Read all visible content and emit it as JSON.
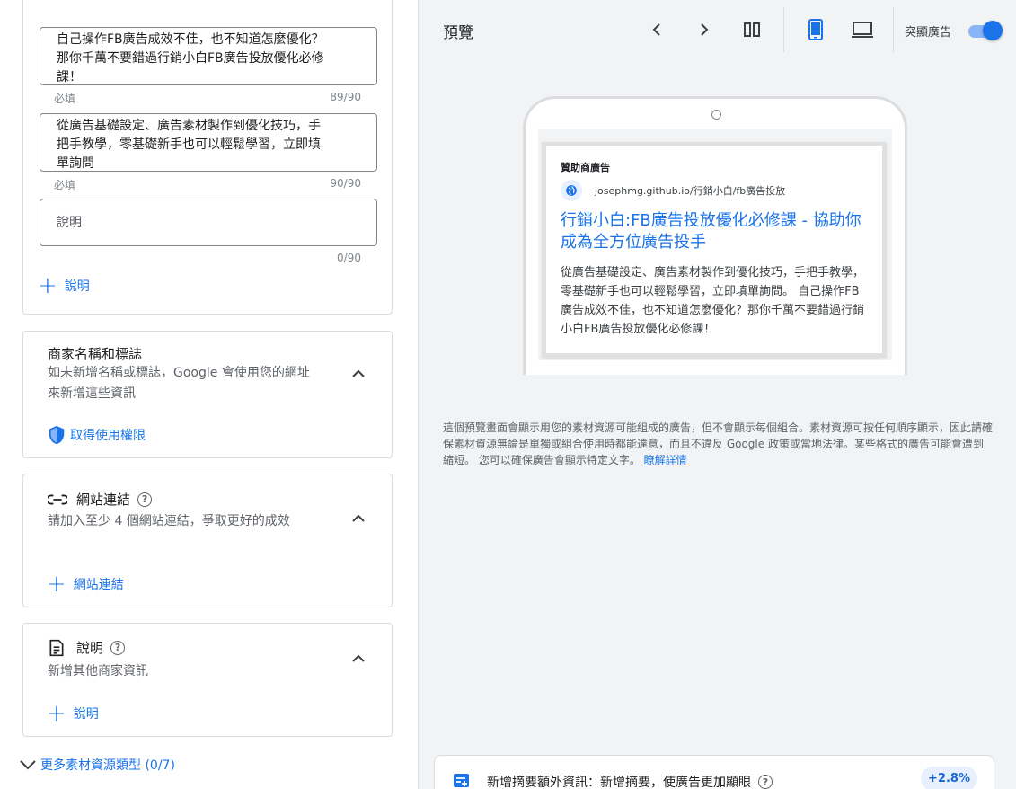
{
  "assets": {
    "field1_text": "自己操作FB廣告成效不佳，也不知道怎麼優化？那你千萬不要錯過行銷小白FB廣告投放優化必修課！",
    "field1_helper": "必填",
    "field1_count": "89/90",
    "field2_text": "從廣告基礎設定、廣告素材製作到優化技巧，手把手教學，零基礎新手也可以輕鬆學習，立即填單詢問",
    "field2_helper": "必填",
    "field2_count": "90/90",
    "field3_placeholder": "說明",
    "field3_count": "0/90",
    "add_description": "說明"
  },
  "business": {
    "title": "商家名稱和標誌",
    "desc": "如未新增名稱或標誌，Google 會使用您的網址來新增這些資訊",
    "action": "取得使用權限"
  },
  "sitelinks": {
    "title": "網站連結",
    "desc": "請加入至少 4 個網站連結，爭取更好的成效",
    "action": "網站連結"
  },
  "callouts": {
    "title": "說明",
    "desc": "新增其他商家資訊",
    "action": "說明"
  },
  "more_types": "更多素材資源類型 (0/7)",
  "preview": {
    "title": "預覽",
    "toggle_label": "突顯廣告",
    "toggle_on": true,
    "ad": {
      "sponsor": "贊助商廣告",
      "url": "josephmg.github.io/行銷小白/fb廣告投放",
      "headline": "行銷小白:FB廣告投放優化必修課 - 協助你成為全方位廣告投手",
      "description": "從廣告基礎設定、廣告素材製作到優化技巧，手把手教學，零基礎新手也可以輕鬆學習，立即填單詢問。 自己操作FB廣告成效不佳，也不知道怎麼優化？那你千萬不要錯過行銷小白FB廣告投放優化必修課！"
    },
    "notice": "這個預覽畫面會顯示用您的素材資源可能組成的廣告，但不會顯示每個組合。素材資源可按任何順序顯示，因此請確保素材資源無論是單獨或組合使用時都能達意，而且不違反 Google 政策或當地法律。某些格式的廣告可能會遭到縮短。 您可以確保廣告會顯示特定文字。",
    "learn_more": "瞭解詳情"
  },
  "bottom": {
    "text": "新增摘要額外資訊：新增摘要，使廣告更加顯眼",
    "badge": "+2.8%"
  },
  "colors": {
    "accent": "#1a73e8",
    "panel_bg": "#f1f3f4",
    "border": "#dadce0"
  }
}
